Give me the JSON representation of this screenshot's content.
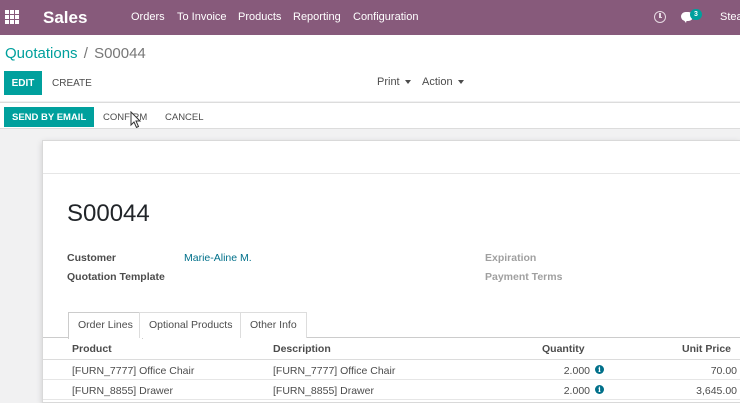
{
  "navbar": {
    "brand": "Sales",
    "menu": [
      "Orders",
      "To Invoice",
      "Products",
      "Reporting",
      "Configuration"
    ],
    "chat_count": "3",
    "user_name": "Stea",
    "icons": [
      "apps-grid-icon",
      "clock-icon",
      "chat-icon"
    ]
  },
  "breadcrumb": {
    "parent": "Quotations",
    "separator": "/",
    "current": "S00044"
  },
  "control": {
    "edit_label": "Edit",
    "create_label": "Create",
    "print_label": "Print",
    "action_label": "Action"
  },
  "statusbar": {
    "send_email_label": "Send by Email",
    "confirm_label": "Confirm",
    "cancel_label": "Cancel"
  },
  "form": {
    "name": "S00044",
    "customer_label": "Customer",
    "customer_value": "Marie-Aline M.",
    "template_label": "Quotation Template",
    "expiration_label": "Expiration",
    "payment_terms_label": "Payment Terms"
  },
  "tabs": [
    "Order Lines",
    "Optional Products",
    "Other Info"
  ],
  "order_lines": {
    "columns": [
      "Product",
      "Description",
      "Quantity",
      "Unit Price"
    ],
    "rows": [
      {
        "product": "[FURN_7777] Office Chair",
        "description": "[FURN_7777] Office Chair",
        "quantity": "2.000",
        "unit_price": "70.00"
      },
      {
        "product": "[FURN_8855] Drawer",
        "description": "[FURN_8855] Drawer",
        "quantity": "2.000",
        "unit_price": "3,645.00"
      }
    ]
  },
  "colors": {
    "navbar": "#875a7b",
    "primary": "#00a09d",
    "link": "#00708a"
  }
}
